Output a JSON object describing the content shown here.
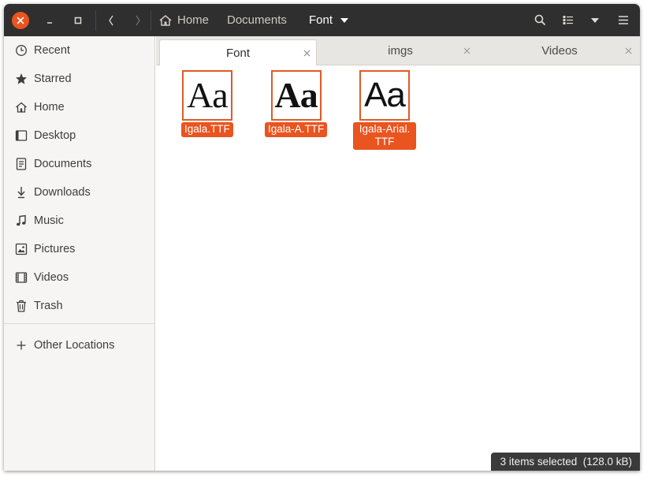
{
  "header": {
    "breadcrumbs": [
      "Home",
      "Documents",
      "Font"
    ]
  },
  "sidebar": {
    "items": [
      {
        "label": "Recent",
        "icon": "clock-icon"
      },
      {
        "label": "Starred",
        "icon": "star-icon"
      },
      {
        "label": "Home",
        "icon": "home-icon"
      },
      {
        "label": "Desktop",
        "icon": "desktop-icon"
      },
      {
        "label": "Documents",
        "icon": "document-icon"
      },
      {
        "label": "Downloads",
        "icon": "download-icon"
      },
      {
        "label": "Music",
        "icon": "music-icon"
      },
      {
        "label": "Pictures",
        "icon": "picture-icon"
      },
      {
        "label": "Videos",
        "icon": "video-icon"
      },
      {
        "label": "Trash",
        "icon": "trash-icon"
      }
    ],
    "other_locations": "Other Locations"
  },
  "tabs": [
    {
      "label": "Font",
      "active": true
    },
    {
      "label": "imgs",
      "active": false
    },
    {
      "label": "Videos",
      "active": false
    }
  ],
  "files": [
    {
      "name_line1": "Igala.TTF",
      "name_line2": "",
      "preview": "Aa",
      "style": "serif"
    },
    {
      "name_line1": "Igala-A.TTF",
      "name_line2": "",
      "preview": "Aa",
      "style": "bold"
    },
    {
      "name_line1": "Igala-Arial.",
      "name_line2": "TTF",
      "preview": "Aa",
      "style": "sans"
    }
  ],
  "status": "3 items selected  (128.0 kB)",
  "colors": {
    "accent": "#e95420",
    "headerbar": "#2f2f2f",
    "sidebar": "#f6f5f4"
  }
}
